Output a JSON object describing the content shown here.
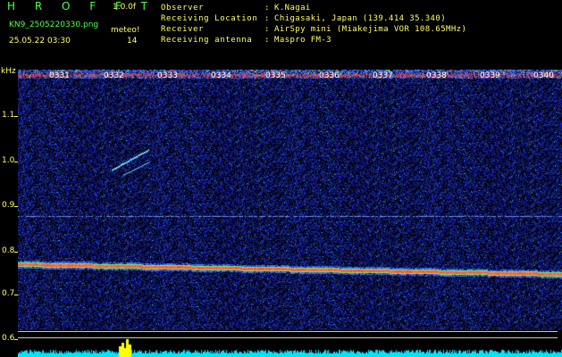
{
  "header": {
    "app_title": "H R O F F T",
    "version": "1.0.0f",
    "filename": "KN9_2505220330.png",
    "datetime": "25.05.22 03:30",
    "meteor_label": "meteo!",
    "meteor_count": "14"
  },
  "info": {
    "observer_label": "Observer",
    "observer_value": "K.Nagai",
    "location_label": "Receiving Location",
    "location_value": "Chigasaki, Japan (139.414 35.340)",
    "receiver_label": "Receiver",
    "receiver_value": "AirSpy mini (Miakejima VOR 108.65MHz)",
    "antenna_label": "Receiving antenna",
    "antenna_value": "Maspro FM-3",
    "colon": ":"
  },
  "axis": {
    "unit": "kHz",
    "ticks": [
      "1.1",
      "1.0",
      "0.9",
      "0.8",
      "0.7",
      "0.6"
    ]
  },
  "time_labels": [
    "0331",
    "0332",
    "0333",
    "0334",
    "0335",
    "0336",
    "0337",
    "0338",
    "0339",
    "0340"
  ],
  "colors": {
    "background": "#000000",
    "noise_blue": "#1a2aa0",
    "header_green": "#4cff4c",
    "header_yellow": "#ffff66",
    "signal_red": "#ff3b3b",
    "graph_cyan": "#00e5ff",
    "graph_yellow": "#ffff00"
  }
}
